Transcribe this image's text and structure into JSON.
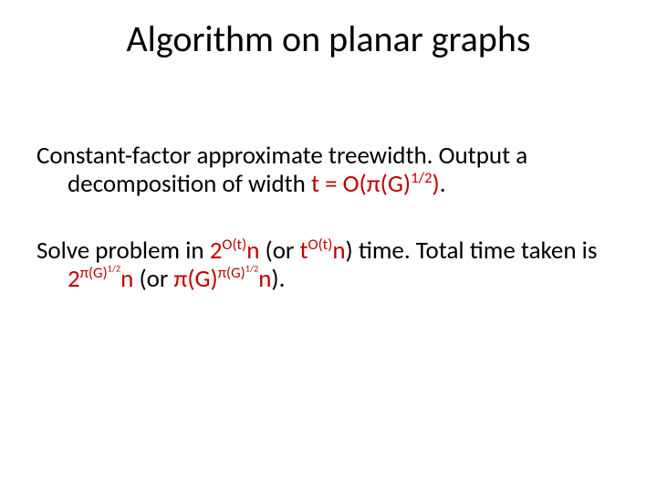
{
  "title": "Algorithm on planar graphs",
  "p1": {
    "t1": "Constant-factor approximate treewidth.  Output a decomposition of width ",
    "hl1": "t = O(π(G)",
    "hl1_sup": "1/2",
    "hl1_close": ")",
    "t2": "."
  },
  "p2": {
    "t1": "Solve problem in ",
    "hl2a": "2",
    "hl2a_sup": "O(t)",
    "hl2a_tail": "n",
    "t2": " (or ",
    "hl2b": "t",
    "hl2b_sup": "O(t)",
    "hl2b_tail": "n",
    "t3": ") time. Total time taken is ",
    "hl2c": "2",
    "hl2c_sup1": "π(G)",
    "hl2c_sup2": "1/2",
    "hl2c_tail": "n",
    "t4": " (or ",
    "hl2d": "π(G)",
    "hl2d_sup1": "π(G)",
    "hl2d_sup2": "1/2",
    "hl2d_tail": "n",
    "t5": ")."
  }
}
